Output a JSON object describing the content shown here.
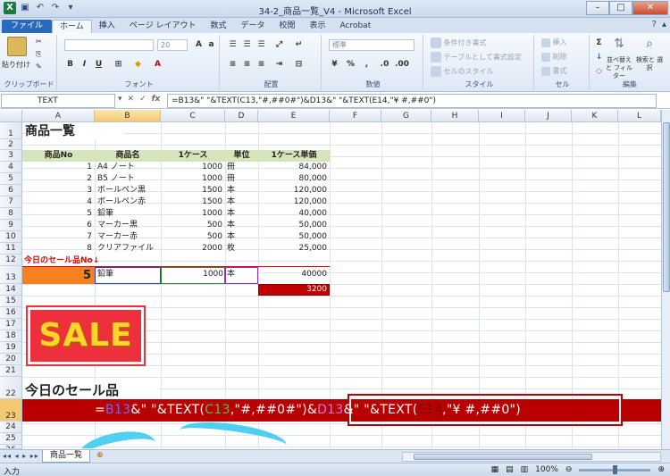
{
  "window": {
    "title": "34-2_商品一覧_V4 - Microsoft Excel"
  },
  "ribbon": {
    "tabs": [
      "ファイル",
      "ホーム",
      "挿入",
      "ページ レイアウト",
      "数式",
      "データ",
      "校閲",
      "表示",
      "Acrobat"
    ],
    "clipboard": {
      "paste_label": "貼り付け",
      "group_label": "クリップボード"
    },
    "font": {
      "size": "20",
      "group_label": "フォント"
    },
    "alignment": {
      "group_label": "配置"
    },
    "number": {
      "format": "標準",
      "group_label": "数値"
    },
    "styles": {
      "cond_format": "条件付き書式",
      "table_format": "テーブルとして書式設定",
      "cell_styles": "セルのスタイル",
      "group_label": "スタイル"
    },
    "cells": {
      "insert": "挿入",
      "delete": "削除",
      "format": "書式",
      "group_label": "セル"
    },
    "editing": {
      "sort_filter": "並べ替えと フィルター",
      "find_select": "検索と 選択",
      "group_label": "編集"
    }
  },
  "formula_bar": {
    "name_box": "TEXT",
    "formula": "=B13&\" \"&TEXT(C13,\"#,##0#\")&D13&\" \"&TEXT(E14,\"¥ #,##0\")"
  },
  "columns": [
    "A",
    "B",
    "C",
    "D",
    "E",
    "F",
    "G",
    "H",
    "I",
    "J",
    "K",
    "L"
  ],
  "rows": [
    "1",
    "2",
    "3",
    "4",
    "5",
    "6",
    "7",
    "8",
    "9",
    "10",
    "11",
    "12",
    "13",
    "14",
    "15",
    "16",
    "17",
    "18",
    "19",
    "20",
    "21",
    "22",
    "23",
    "24",
    "25",
    "26"
  ],
  "sheet": {
    "title": "商品一覧",
    "headers": [
      "商品No",
      "商品名",
      "1ケース",
      "単位",
      "1ケース単価"
    ],
    "products": [
      {
        "no": "1",
        "name": "A4 ノート",
        "qty": "1000",
        "unit": "冊",
        "price": "84,000"
      },
      {
        "no": "2",
        "name": "B5 ノート",
        "qty": "1000",
        "unit": "冊",
        "price": "80,000"
      },
      {
        "no": "3",
        "name": "ボールペン黒",
        "qty": "1500",
        "unit": "本",
        "price": "120,000"
      },
      {
        "no": "4",
        "name": "ボールペン赤",
        "qty": "1500",
        "unit": "本",
        "price": "120,000"
      },
      {
        "no": "5",
        "name": "鉛筆",
        "qty": "1000",
        "unit": "本",
        "price": "40,000"
      },
      {
        "no": "6",
        "name": "マーカー黒",
        "qty": "500",
        "unit": "本",
        "price": "50,000"
      },
      {
        "no": "7",
        "name": "マーカー赤",
        "qty": "500",
        "unit": "本",
        "price": "50,000"
      },
      {
        "no": "8",
        "name": "クリアファイル",
        "qty": "2000",
        "unit": "枚",
        "price": "25,000"
      }
    ],
    "sale_label": "今日のセール品No↓",
    "sale_no": "5",
    "sale_name": "鉛筆",
    "sale_qty": "1000",
    "sale_unit": "本",
    "sale_price": "40000",
    "sale_discount": "3200",
    "sale_banner": "SALE",
    "today_title": "今日のセール品",
    "edit_formula": {
      "eq": "=",
      "ref1": "B13",
      "p1": "&\" \"&TEXT(",
      "ref2": "C13",
      "p2": ",\"#,##0#\"",
      "p3": ")&",
      "ref3": "D13",
      "p4": "&\" \"&TEXT(",
      "ref4": "E14",
      "p5": ",\"¥ #,##0\")"
    }
  },
  "sheet_tab": "商品一覧",
  "status": {
    "mode": "入力",
    "zoom": "100%"
  }
}
